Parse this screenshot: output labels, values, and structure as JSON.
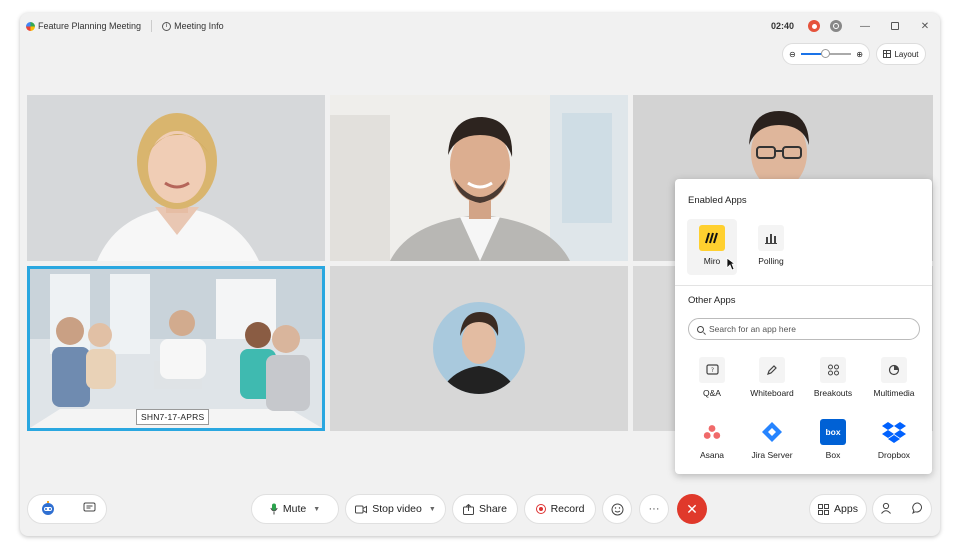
{
  "titlebar": {
    "meeting_title": "Feature Planning Meeting",
    "meeting_info": "Meeting Info",
    "timer": "02:40"
  },
  "toolbar_top": {
    "zoom_out": "⊖",
    "zoom_in": "⊕",
    "layout_label": "Layout"
  },
  "participants": [
    {
      "position": "top-left"
    },
    {
      "position": "top-center"
    },
    {
      "position": "top-right"
    },
    {
      "position": "bottom-left",
      "name": "SHN7-17-APRS"
    },
    {
      "position": "bottom-center"
    }
  ],
  "apps_panel": {
    "enabled_title": "Enabled Apps",
    "enabled_apps": [
      {
        "label": "Miro",
        "icon": "miro-icon"
      },
      {
        "label": "Polling",
        "icon": "polling-icon"
      }
    ],
    "other_title": "Other Apps",
    "search_placeholder": "Search for an app here",
    "other_apps": [
      {
        "label": "Q&A",
        "icon": "qa-icon"
      },
      {
        "label": "Whiteboard",
        "icon": "whiteboard-icon"
      },
      {
        "label": "Breakouts",
        "icon": "breakouts-icon"
      },
      {
        "label": "Multimedia",
        "icon": "multimedia-icon"
      },
      {
        "label": "Asana",
        "icon": "asana-icon"
      },
      {
        "label": "Jira Server",
        "icon": "jira-icon"
      },
      {
        "label": "Box",
        "icon": "box-icon"
      },
      {
        "label": "Dropbox",
        "icon": "dropbox-icon"
      }
    ],
    "brand_colors": {
      "miro": "#ffd02f",
      "asana": "#f06a6a",
      "jira": "#2684ff",
      "box": "#0061d5",
      "dropbox": "#0061fe"
    }
  },
  "bottombar": {
    "mute_label": "Mute",
    "stop_video_label": "Stop video",
    "share_label": "Share",
    "record_label": "Record",
    "apps_label": "Apps",
    "end_symbol": "✕",
    "more_symbol": "···"
  },
  "colors": {
    "active_speaker_border": "#2aa7e0",
    "end_call": "#e0392b",
    "recording": "#e5533c"
  }
}
